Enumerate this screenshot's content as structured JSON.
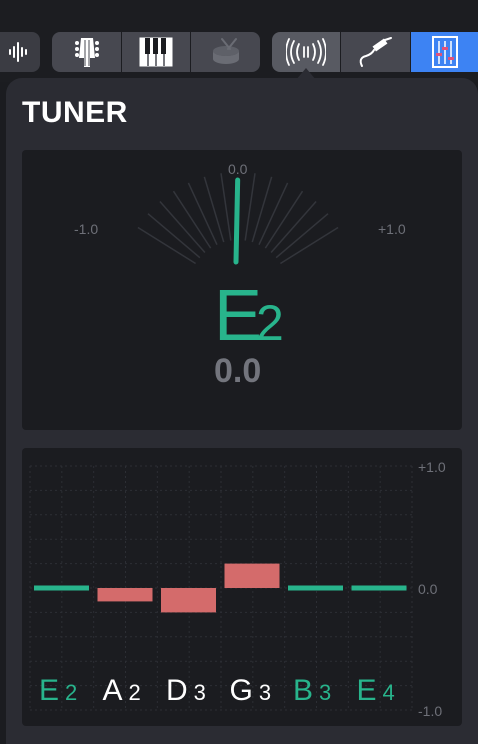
{
  "colors": {
    "accent": "#28b48c",
    "flat": "#d46b6b",
    "sharp": "#d46b6b",
    "active_button": "#3d83f3",
    "panel": "#2b2c33"
  },
  "toolbar": {
    "buttons": [
      {
        "icon": "waveform-icon"
      },
      {
        "icon": "guitar-headstock-icon"
      },
      {
        "icon": "piano-keys-icon"
      },
      {
        "icon": "drum-icon"
      },
      {
        "icon": "tuner-broadcast-icon"
      },
      {
        "icon": "instrument-cable-icon"
      },
      {
        "icon": "mixer-fader-icon"
      }
    ]
  },
  "tuner": {
    "title": "TUNER",
    "meter": {
      "left_label": "-1.0",
      "center_label": "0.0",
      "right_label": "+1.0",
      "note_letter": "E",
      "note_octave": "2",
      "cents_value": "0.0",
      "needle_deviation": 0.02
    },
    "strings_panel": {
      "y_top_label": "+1.0",
      "y_mid_label": "0.0",
      "y_bottom_label": "-1.0",
      "ylim": [
        -1.0,
        1.0
      ],
      "strings": [
        {
          "letter": "E",
          "octave": "2",
          "deviation": 0.0,
          "in_tune": true
        },
        {
          "letter": "A",
          "octave": "2",
          "deviation": -0.11,
          "in_tune": false
        },
        {
          "letter": "D",
          "octave": "3",
          "deviation": -0.2,
          "in_tune": false
        },
        {
          "letter": "G",
          "octave": "3",
          "deviation": 0.2,
          "in_tune": false
        },
        {
          "letter": "B",
          "octave": "3",
          "deviation": 0.0,
          "in_tune": true
        },
        {
          "letter": "E",
          "octave": "4",
          "deviation": 0.0,
          "in_tune": true
        }
      ]
    }
  }
}
